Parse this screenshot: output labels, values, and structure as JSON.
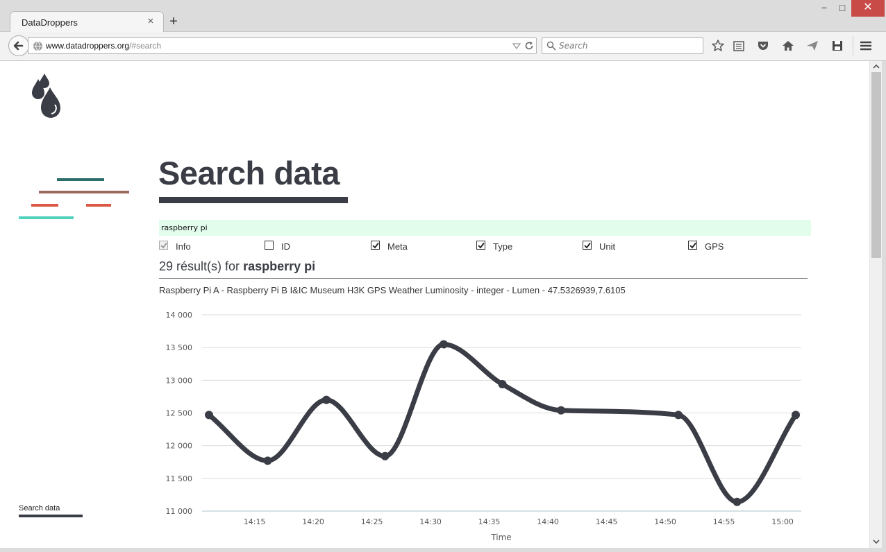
{
  "browser": {
    "tab_title": "DataDroppers",
    "tab_close": "×",
    "new_tab": "+",
    "url_host": "www.datadroppers.org",
    "url_path": "/#search",
    "search_placeholder": "Search",
    "window_min": "−",
    "window_max": "□",
    "window_close": "✕"
  },
  "sidebar": {
    "footer_link": "Search data"
  },
  "main": {
    "title": "Search data",
    "query": "raspberry pi",
    "filters": [
      {
        "label": "Info",
        "checked": true,
        "disabled": true
      },
      {
        "label": "ID",
        "checked": false,
        "disabled": false
      },
      {
        "label": "Meta",
        "checked": true,
        "disabled": false
      },
      {
        "label": "Type",
        "checked": true,
        "disabled": false
      },
      {
        "label": "Unit",
        "checked": true,
        "disabled": false
      },
      {
        "label": "GPS",
        "checked": true,
        "disabled": false
      }
    ],
    "results_count_prefix": "29 résult(s) for",
    "results_count_query": "raspberry pi",
    "result_description": "Raspberry Pi A - Raspberry Pi B I&IC Museum H3K GPS Weather Luminosity - integer - Lumen - 47.5326939,7.6105"
  },
  "colors": {
    "accent_dark": "#3a3d45",
    "query_bg": "#e3fded",
    "line_teal_dark": "#2e6e6a",
    "line_brown": "#9a6a5c",
    "line_red": "#dd5745",
    "line_teal_light": "#4fd1bd"
  },
  "chart_data": {
    "type": "line",
    "xlabel": "Time",
    "ylabel": "",
    "ylim": [
      11000,
      14000
    ],
    "yticks": [
      11000,
      11500,
      12000,
      12500,
      13000,
      13500,
      14000
    ],
    "ytick_labels": [
      "11 000",
      "11 500",
      "12 000",
      "12 500",
      "13 000",
      "13 500",
      "14 000"
    ],
    "xlim": [
      "14:11",
      "15:00"
    ],
    "xticks": [
      "14:15",
      "14:20",
      "14:25",
      "14:30",
      "14:35",
      "14:40",
      "14:45",
      "14:50",
      "14:55",
      "15:00"
    ],
    "grid": true,
    "series": [
      {
        "x": [
          "14:11",
          "14:16",
          "14:21",
          "14:26",
          "14:31",
          "14:36",
          "14:41",
          "14:51",
          "14:56",
          "15:01"
        ],
        "y": [
          12470,
          11770,
          12700,
          11840,
          13550,
          12940,
          12540,
          12470,
          11140,
          12470
        ]
      }
    ]
  }
}
